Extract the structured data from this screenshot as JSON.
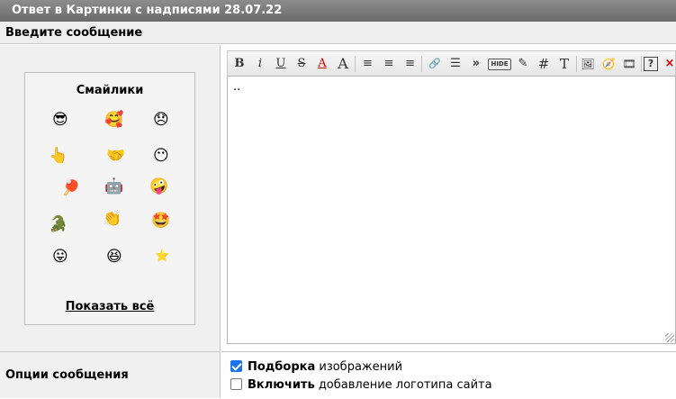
{
  "window": {
    "title": "Ответ в Картинки с надписями 28.07.22"
  },
  "header": {
    "label": "Введите сообщение"
  },
  "smilies": {
    "title": "Смайлики",
    "show_all": "Показать всё",
    "items": [
      "😎",
      "🥰",
      "😞",
      "👆",
      "🤝",
      "😶",
      "🏓",
      "🤖",
      "🤪",
      "🐊",
      "👏",
      "🤩",
      "😛",
      "😆",
      "⭐"
    ]
  },
  "toolbar": {
    "buttons": [
      "B",
      "i",
      "U",
      "S",
      "A",
      "A",
      "≡",
      "≡",
      "≡",
      "🔗",
      "☰",
      "»",
      "HIDE",
      "✎",
      "#",
      "T",
      "🖼",
      "🧭",
      "🎞",
      "?",
      "×"
    ]
  },
  "editor": {
    "value": ".."
  },
  "options": {
    "label": "Опции сообщения",
    "opt1_bold": "Подборка",
    "opt1_text": " изображений",
    "opt1_checked": true,
    "opt2_bold": "Включить",
    "opt2_text": " добавление логотипа сайта",
    "opt2_checked": false
  },
  "colors": {
    "accent": "#1a73e8",
    "title_bg": "#7a7a7a"
  }
}
